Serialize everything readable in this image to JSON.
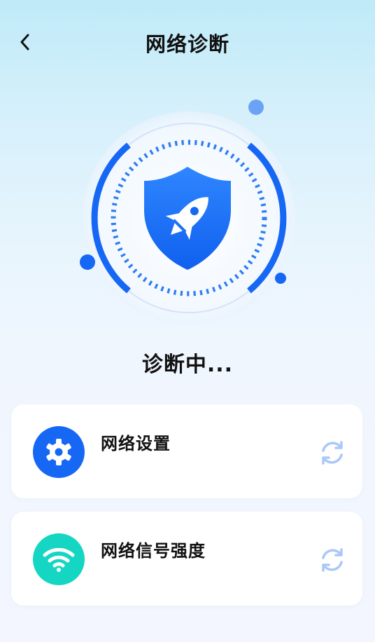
{
  "header": {
    "title": "网络诊断",
    "back_icon": "chevron-left-icon"
  },
  "hero": {
    "icon": "shield-rocket-icon",
    "accent": "#1767f5"
  },
  "status_text": "诊断中...",
  "items": [
    {
      "label": "网络设置",
      "icon": "gear-icon",
      "icon_bg": "#1767f5",
      "action_icon": "refresh-icon"
    },
    {
      "label": "网络信号强度",
      "icon": "wifi-icon",
      "icon_bg": "#14d6c2",
      "action_icon": "refresh-icon"
    }
  ]
}
